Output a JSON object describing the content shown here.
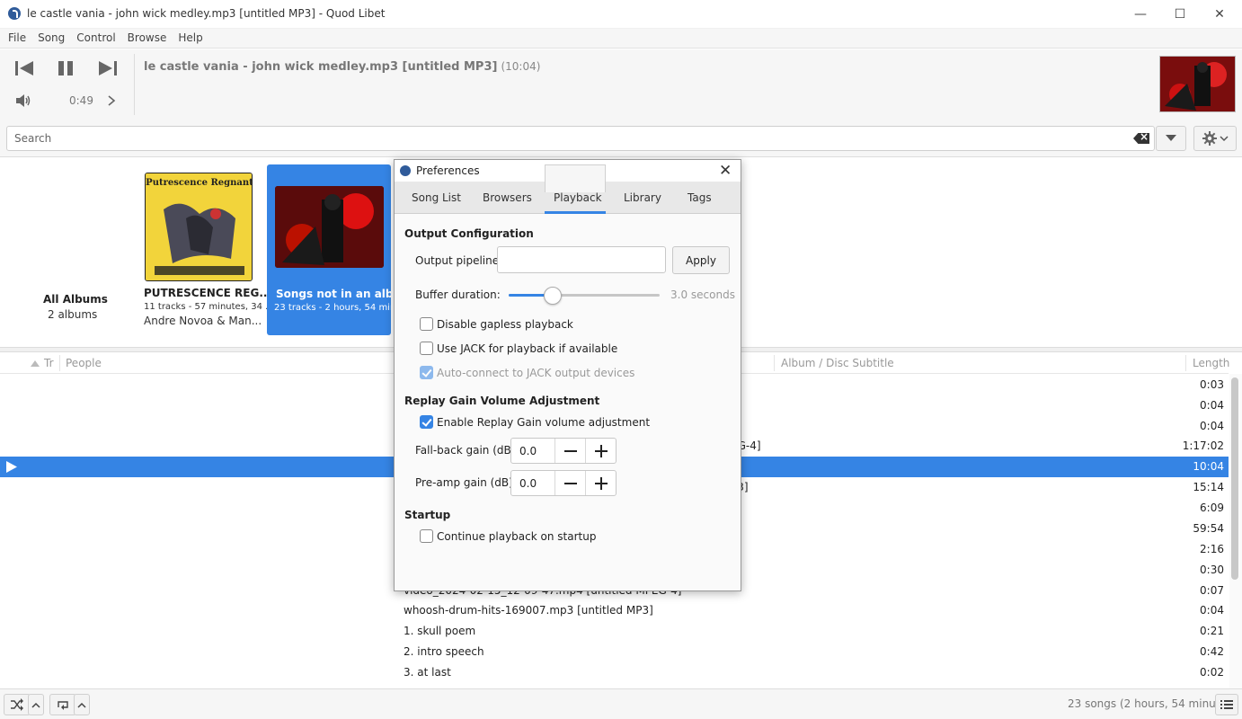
{
  "window": {
    "title": "le castle vania - john wick medley.mp3 [untitled MP3] - Quod Libet",
    "minimize": "—",
    "maximize": "☐",
    "close": "✕"
  },
  "menu": [
    "File",
    "Song",
    "Control",
    "Browse",
    "Help"
  ],
  "player": {
    "song_title": "le castle vania - john wick medley.mp3 [untitled MP3]",
    "song_length": "(10:04)",
    "elapsed": "0:49",
    "progress_fraction": 0.081
  },
  "search": {
    "placeholder": "Search"
  },
  "albums": {
    "all": {
      "title": "All Albums",
      "count": "2 albums"
    },
    "items": [
      {
        "title": "PUTRESCENCE REG...",
        "subtitle": "11 tracks - 57 minutes, 34 ...",
        "artist": "Andre Novoa & Man...",
        "cover_text": "Putrescence Regnant",
        "cover_color": "#f2d43b"
      },
      {
        "title": "Songs not in an album",
        "subtitle": "23 tracks - 2 hours, 54 min..."
      }
    ]
  },
  "song_list": {
    "columns": {
      "track": "Tr",
      "people": "People",
      "album": "Album / Disc Subtitle",
      "length": "Length"
    },
    "rows": [
      {
        "title": "",
        "album": "",
        "length": "0:03"
      },
      {
        "title": "",
        "album": "",
        "length": "0:04"
      },
      {
        "title": "",
        "album": "",
        "length": "0:04"
      },
      {
        "title": "",
        "album": "EG-4]",
        "length": "1:17:02"
      },
      {
        "title": "",
        "album": "",
        "length": "10:04",
        "selected": true
      },
      {
        "title": "",
        "album": "P3]",
        "length": "15:14"
      },
      {
        "title": "",
        "album": "",
        "length": "6:09"
      },
      {
        "title": "",
        "album": "",
        "length": "59:54"
      },
      {
        "title": "",
        "album": "",
        "length": "2:16"
      },
      {
        "title": "",
        "album": "",
        "length": "0:30"
      },
      {
        "title": "video_2024-02-15_12-09-47.mp4 [untitled MPEG-4]",
        "album": "",
        "length": "0:07"
      },
      {
        "title": "whoosh-drum-hits-169007.mp3 [untitled MP3]",
        "album": "",
        "length": "0:04"
      },
      {
        "title": "1. skull poem",
        "album": "",
        "length": "0:21"
      },
      {
        "title": "2. intro speech",
        "album": "",
        "length": "0:42"
      },
      {
        "title": "3. at last",
        "album": "",
        "length": "0:02"
      }
    ]
  },
  "status": {
    "text": "23 songs (2 hours, 54 minutes)"
  },
  "preferences": {
    "title": "Preferences",
    "tabs": [
      "Song List",
      "Browsers",
      "Playback",
      "Library",
      "Tags"
    ],
    "active_tab": "Playback",
    "output": {
      "heading": "Output Configuration",
      "pipeline_label": "Output pipeline:",
      "pipeline_value": "",
      "apply": "Apply",
      "buffer_label": "Buffer duration:",
      "buffer_value": "3.0 seconds",
      "buffer_fraction": 0.29,
      "gapless": {
        "label": "Disable gapless playback",
        "checked": false
      },
      "jack": {
        "label": "Use JACK for playback if available",
        "checked": false
      },
      "jack_autoconnect": {
        "label": "Auto-connect to JACK output devices",
        "checked": true,
        "disabled": true
      }
    },
    "replay_gain": {
      "heading": "Replay Gain Volume Adjustment",
      "enable": {
        "label": "Enable Replay Gain volume adjustment",
        "checked": true
      },
      "fallback_label": "Fall-back gain (dB):",
      "fallback_value": "0.0",
      "preamp_label": "Pre-amp gain (dB):",
      "preamp_value": "0.0"
    },
    "startup": {
      "heading": "Startup",
      "continue": {
        "label": "Continue playback on startup",
        "checked": false
      }
    }
  }
}
